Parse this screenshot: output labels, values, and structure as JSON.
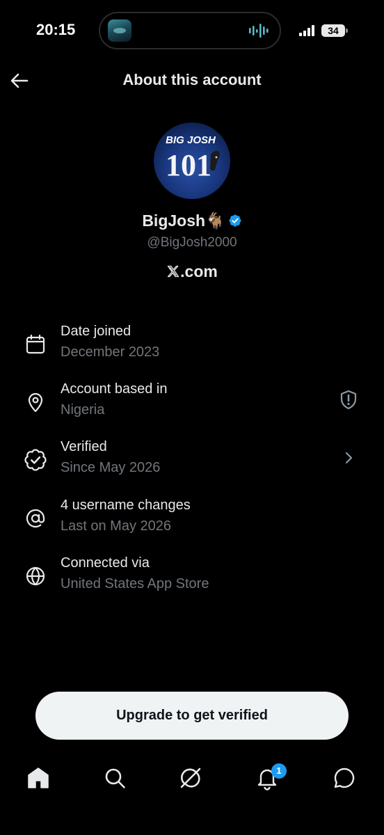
{
  "status_bar": {
    "time": "20:15",
    "battery": "34"
  },
  "header": {
    "title": "About this account"
  },
  "profile": {
    "avatar_text": {
      "line1": "BIG JOSH",
      "line2": "101"
    },
    "display_name": "BigJosh",
    "name_emoji": "🐐",
    "handle": "@BigJosh2000",
    "client_text": ".com"
  },
  "info_rows": [
    {
      "icon": "calendar-icon",
      "label": "Date joined",
      "value": "December 2023"
    },
    {
      "icon": "location-pin-icon",
      "label": "Account based in",
      "value": "Nigeria",
      "trailing_icon": "shield-alert-icon"
    },
    {
      "icon": "verified-outline-icon",
      "label": "Verified",
      "value": "Since May 2026",
      "trailing_icon": "chevron-right-icon"
    },
    {
      "icon": "at-sign-icon",
      "label": "4 username changes",
      "value": "Last on May 2026"
    },
    {
      "icon": "globe-icon",
      "label": "Connected via",
      "value": "United States App Store"
    }
  ],
  "cta": {
    "label": "Upgrade to get verified"
  },
  "tab_bar": {
    "items": [
      "home-icon",
      "search-icon",
      "grok-icon",
      "notifications-icon",
      "messages-icon"
    ],
    "notification_count": "1"
  },
  "colors": {
    "background": "#000000",
    "primary_text": "#e7e9ea",
    "secondary_text": "#71767b",
    "accent_blue": "#1d9bf0",
    "button_bg": "#eff3f4"
  }
}
